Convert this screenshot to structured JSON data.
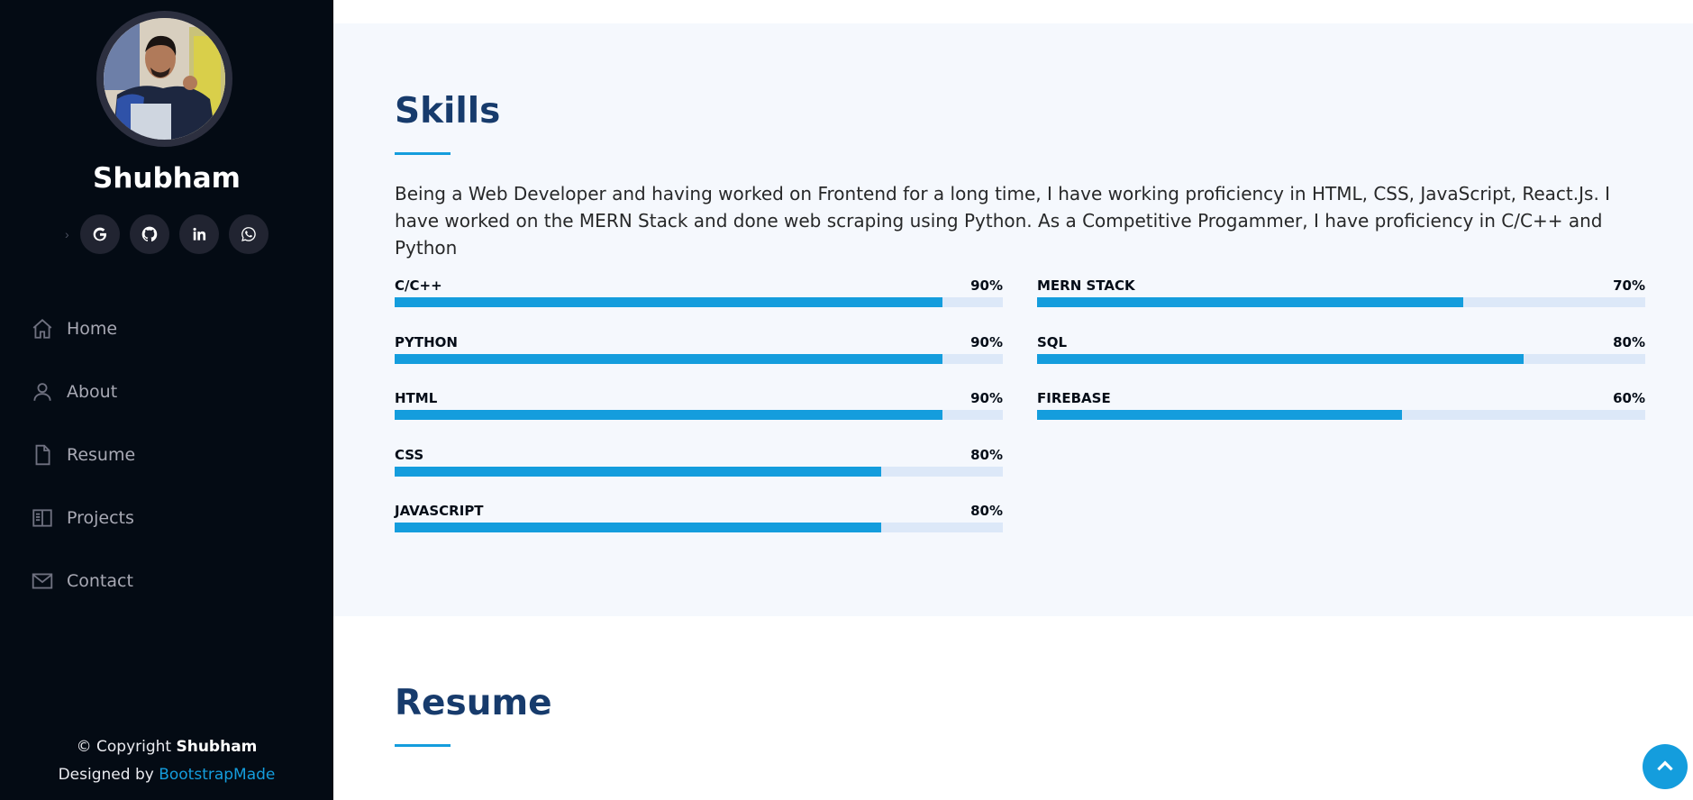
{
  "profile": {
    "name": "Shubham"
  },
  "social": [
    {
      "name": "google-icon"
    },
    {
      "name": "github-icon"
    },
    {
      "name": "linkedin-icon"
    },
    {
      "name": "whatsapp-icon"
    }
  ],
  "nav": {
    "items": [
      {
        "label": "Home",
        "icon": "home-icon"
      },
      {
        "label": "About",
        "icon": "person-icon"
      },
      {
        "label": "Resume",
        "icon": "file-icon"
      },
      {
        "label": "Projects",
        "icon": "book-icon"
      },
      {
        "label": "Contact",
        "icon": "envelope-icon"
      }
    ]
  },
  "footer": {
    "copyright_prefix": "© Copyright ",
    "copyright_name": "Shubham",
    "designed_prefix": "Designed by ",
    "designed_link": "BootstrapMade"
  },
  "skills": {
    "title": "Skills",
    "description": "Being a Web Developer and having worked on Frontend for a long time, I have working proficiency in HTML, CSS, JavaScript, React.Js. I have worked on the MERN Stack and done web scraping using Python. As a Competitive Progammer, I have proficiency in C/C++ and Python",
    "left": [
      {
        "label": "C/C++",
        "value": "90%",
        "percent": 90
      },
      {
        "label": "PYTHON",
        "value": "90%",
        "percent": 90
      },
      {
        "label": "HTML",
        "value": "90%",
        "percent": 90
      },
      {
        "label": "CSS",
        "value": "80%",
        "percent": 80
      },
      {
        "label": "JAVASCRIPT",
        "value": "80%",
        "percent": 80
      }
    ],
    "right": [
      {
        "label": "MERN STACK",
        "value": "70%",
        "percent": 70
      },
      {
        "label": "SQL",
        "value": "80%",
        "percent": 80
      },
      {
        "label": "FIREBASE",
        "value": "60%",
        "percent": 60
      }
    ]
  },
  "resume": {
    "title": "Resume"
  },
  "colors": {
    "accent": "#149ddd",
    "sidebar_bg": "#040b14",
    "title": "#173b6c",
    "track": "#dce8f8",
    "section_bg": "#f5f8fd"
  }
}
